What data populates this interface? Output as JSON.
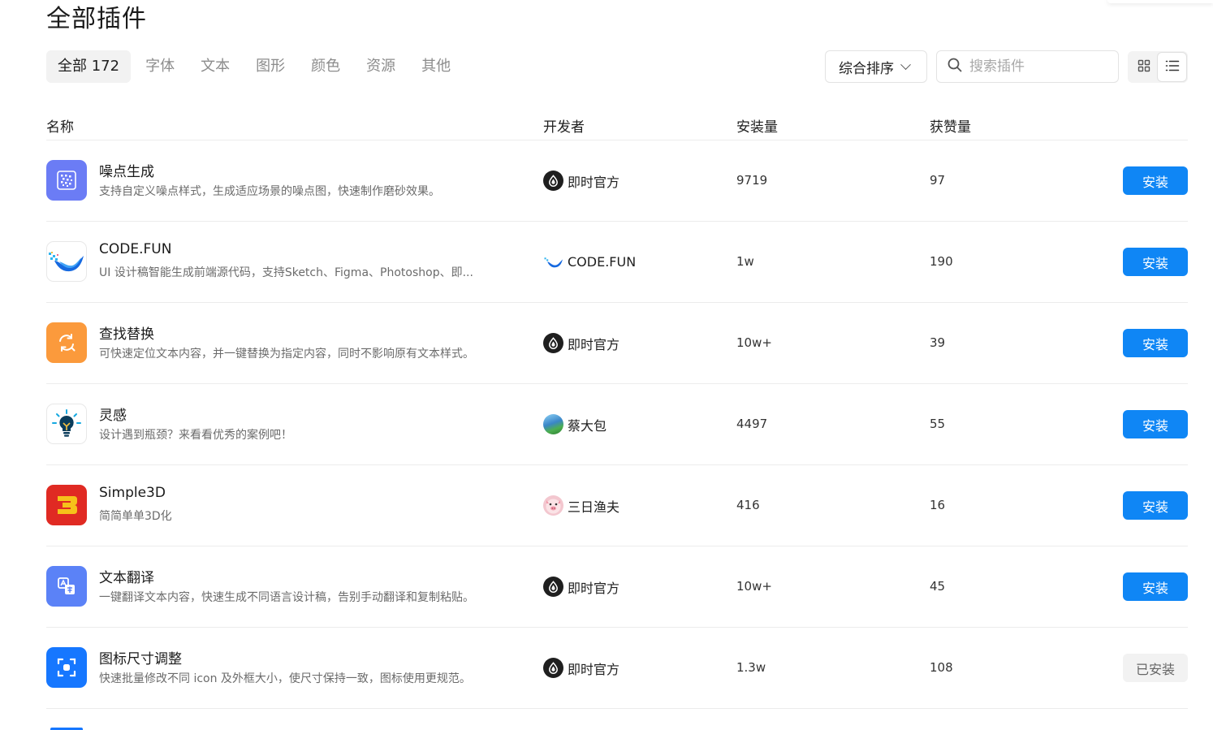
{
  "page": {
    "title": "全部插件"
  },
  "tabs": [
    {
      "label": "全部 172",
      "active": true
    },
    {
      "label": "字体"
    },
    {
      "label": "文本"
    },
    {
      "label": "图形"
    },
    {
      "label": "颜色"
    },
    {
      "label": "资源"
    },
    {
      "label": "其他"
    }
  ],
  "toolbar": {
    "sort_label": "综合排序",
    "search_placeholder": "搜索插件",
    "view_mode": "list"
  },
  "table": {
    "columns": {
      "name": "名称",
      "developer": "开发者",
      "installs": "安装量",
      "likes": "获赞量"
    },
    "rows": [
      {
        "name": "噪点生成",
        "desc": "支持自定义噪点样式，生成适应场景的噪点图，快速制作磨砂效果。",
        "developer": "即时官方",
        "installs": "9719",
        "likes": "97",
        "action": "安装",
        "icon": "noise-icon"
      },
      {
        "name": "CODE.FUN",
        "desc": "UI 设计稿智能生成前端源代码，支持Sketch、Figma、Photoshop、即...",
        "developer": "CODE.FUN",
        "installs": "1w",
        "likes": "190",
        "action": "安装",
        "icon": "codefun-bird-icon"
      },
      {
        "name": "查找替换",
        "desc": "可快速定位文本内容，并一键替换为指定内容，同时不影响原有文本样式。",
        "developer": "即时官方",
        "installs": "10w+",
        "likes": "39",
        "action": "安装",
        "icon": "find-replace-icon"
      },
      {
        "name": "灵感",
        "desc": "设计遇到瓶颈？来看看优秀的案例吧！",
        "developer": "蔡大包",
        "installs": "4497",
        "likes": "55",
        "action": "安装",
        "icon": "lightbulb-icon"
      },
      {
        "name": "Simple3D",
        "desc": "简简单单3D化",
        "developer": "三日渔夫",
        "installs": "416",
        "likes": "16",
        "action": "安装",
        "icon": "simple3d-icon"
      },
      {
        "name": "文本翻译",
        "desc": "一键翻译文本内容，快速生成不同语言设计稿，告别手动翻译和复制粘贴。",
        "developer": "即时官方",
        "installs": "10w+",
        "likes": "45",
        "action": "安装",
        "icon": "translate-icon"
      },
      {
        "name": "图标尺寸调整",
        "desc": "快速批量修改不同 icon 及外框大小，使尺寸保持一致，图标使用更规范。",
        "developer": "即时官方",
        "installs": "1.3w",
        "likes": "108",
        "action": "已安装",
        "icon": "icon-resize-icon"
      }
    ]
  },
  "colors": {
    "accent": "#0f86f5",
    "installed_bg": "#f2f2f2",
    "border": "#ececec"
  }
}
